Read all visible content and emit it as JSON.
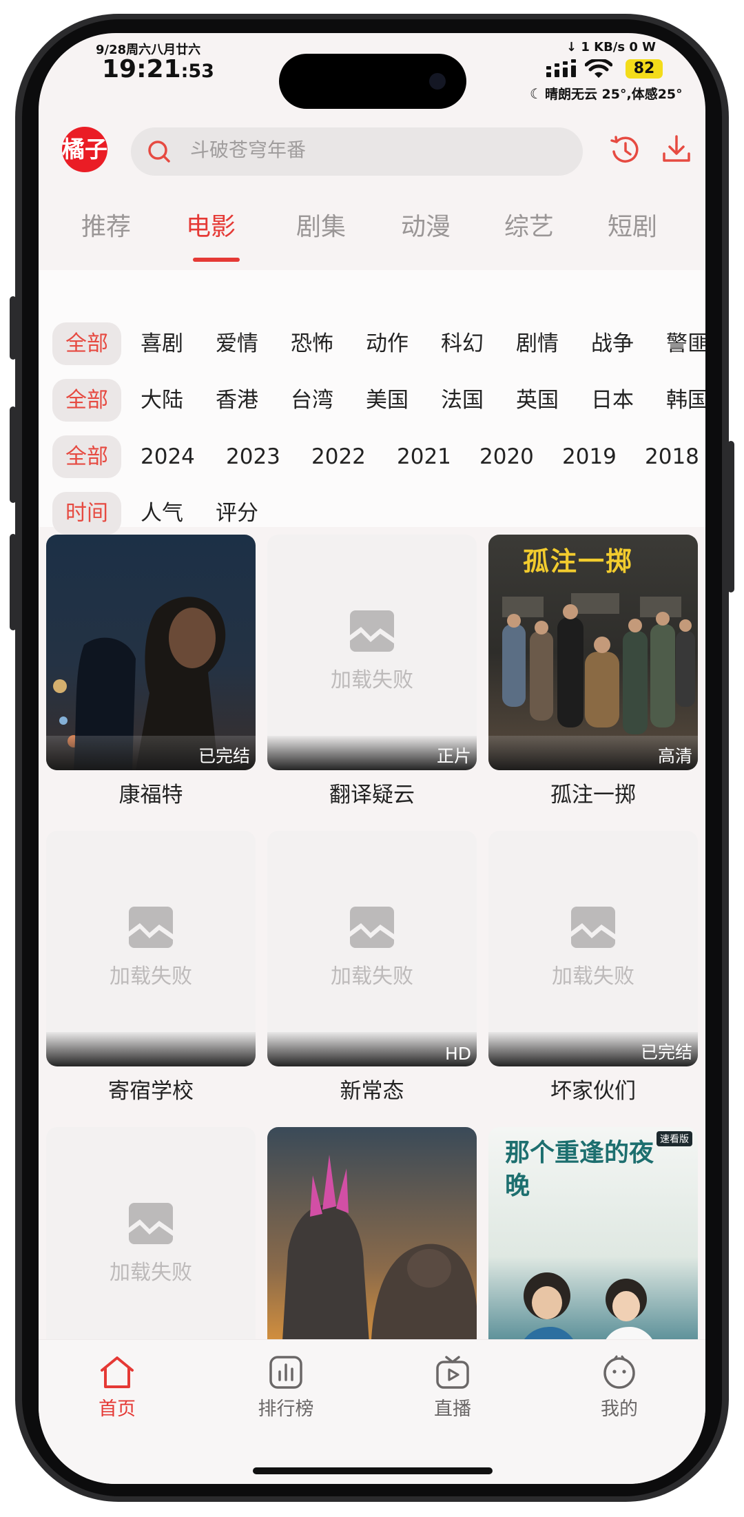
{
  "status_bar": {
    "date": "9/28周六八月廿六",
    "time": "19:21",
    "seconds": ":53",
    "network_speed": "↓ 1 KB/s  0 W",
    "battery": "82",
    "weather": "晴朗无云 25°,体感25°"
  },
  "header": {
    "logo_text": "橘子",
    "search_placeholder": "斗破苍穹年番"
  },
  "tabs": [
    {
      "label": "推荐"
    },
    {
      "label": "电影"
    },
    {
      "label": "剧集"
    },
    {
      "label": "动漫"
    },
    {
      "label": "综艺"
    },
    {
      "label": "短剧"
    }
  ],
  "active_tab": "电影",
  "filters": {
    "genre": {
      "selected": "全部",
      "options": [
        "喜剧",
        "爱情",
        "恐怖",
        "动作",
        "科幻",
        "剧情",
        "战争",
        "警匪"
      ]
    },
    "region": {
      "selected": "全部",
      "options": [
        "大陆",
        "香港",
        "台湾",
        "美国",
        "法国",
        "英国",
        "日本",
        "韩国"
      ]
    },
    "year": {
      "selected": "全部",
      "options": [
        "2024",
        "2023",
        "2022",
        "2021",
        "2020",
        "2019",
        "2018"
      ]
    },
    "sort": {
      "selected": "时间",
      "options": [
        "人气",
        "评分"
      ]
    }
  },
  "load_failed_text": "加载失败",
  "movies": [
    {
      "title": "康福特",
      "badge": "已完结",
      "image": "night-bokeh-couple"
    },
    {
      "title": "翻译疑云",
      "badge": "正片",
      "image": "load-failed"
    },
    {
      "title": "孤注一掷",
      "badge": "高清",
      "image": "group-poster",
      "poster_title": "孤注一掷"
    },
    {
      "title": "寄宿学校",
      "badge": "",
      "image": "load-failed"
    },
    {
      "title": "新常态",
      "badge": "HD",
      "image": "load-failed"
    },
    {
      "title": "坏家伙们",
      "badge": "已完结",
      "image": "load-failed"
    },
    {
      "title": "",
      "badge": "",
      "image": "load-failed"
    },
    {
      "title": "",
      "badge": "",
      "image": "monster-poster"
    },
    {
      "title": "",
      "badge": "",
      "image": "girls-poster",
      "poster_title": "那个重逢的夜晚",
      "poster_tag": "速看版"
    }
  ],
  "bottom_nav": [
    {
      "label": "首页",
      "icon": "home-icon"
    },
    {
      "label": "排行榜",
      "icon": "chart-icon"
    },
    {
      "label": "直播",
      "icon": "tv-icon"
    },
    {
      "label": "我的",
      "icon": "face-icon"
    }
  ],
  "colors": {
    "accent": "#e53935",
    "background": "#f7f3f3",
    "logo": "#ea1d25"
  }
}
